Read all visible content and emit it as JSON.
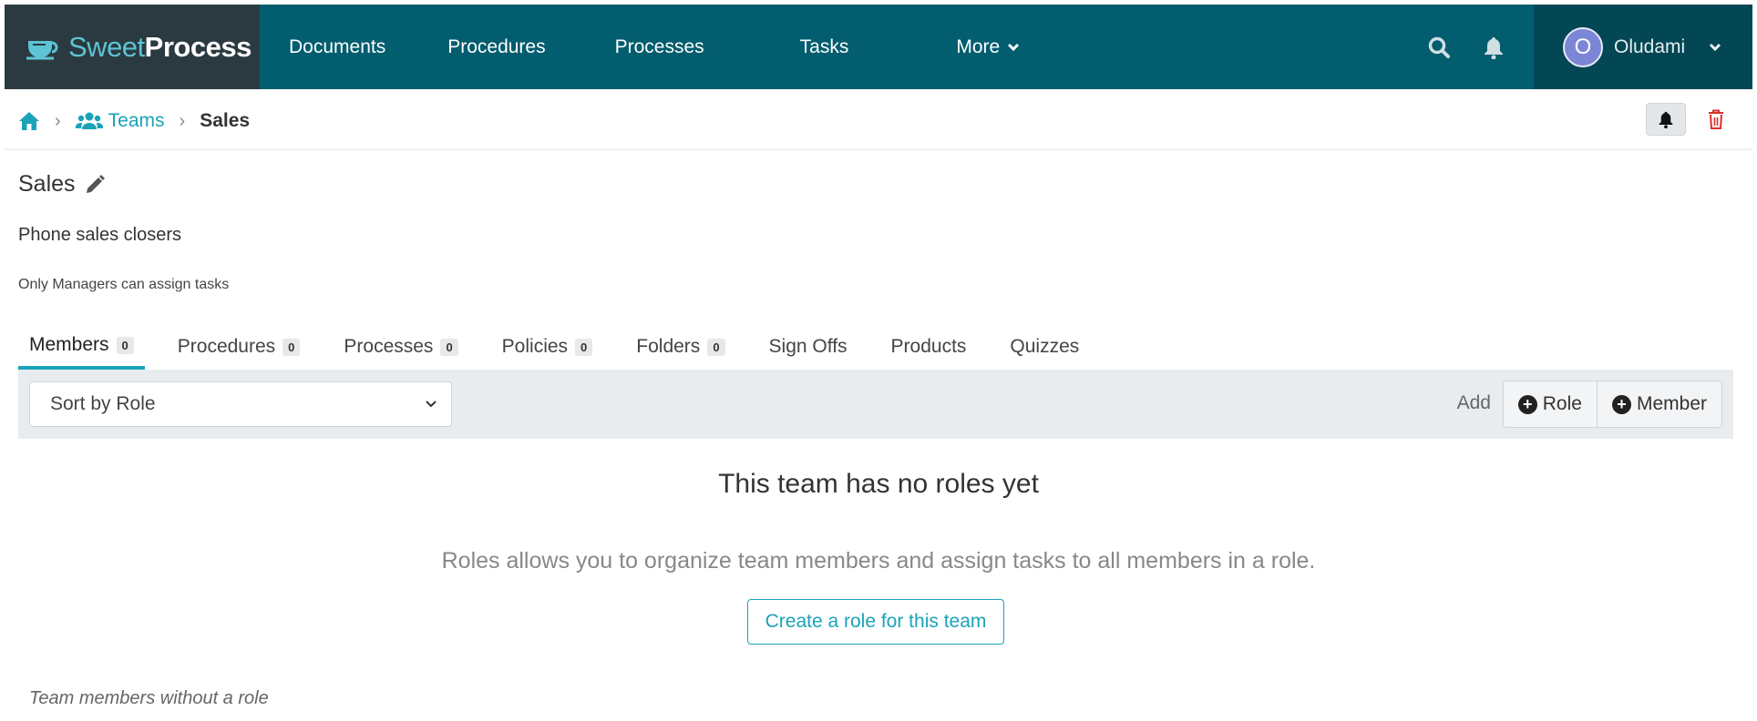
{
  "brand": {
    "name_light": "Sweet",
    "name_bold": "Process"
  },
  "nav": {
    "items": [
      {
        "label": "Documents"
      },
      {
        "label": "Procedures"
      },
      {
        "label": "Processes"
      },
      {
        "label": "Tasks"
      },
      {
        "label": "More"
      }
    ],
    "user": {
      "initial": "O",
      "name": "Oludami"
    }
  },
  "breadcrumb": {
    "teams": "Teams",
    "current": "Sales"
  },
  "team": {
    "title": "Sales",
    "description": "Phone sales closers",
    "note": "Only Managers can assign tasks"
  },
  "tabs": [
    {
      "label": "Members",
      "count": "0"
    },
    {
      "label": "Procedures",
      "count": "0"
    },
    {
      "label": "Processes",
      "count": "0"
    },
    {
      "label": "Policies",
      "count": "0"
    },
    {
      "label": "Folders",
      "count": "0"
    },
    {
      "label": "Sign Offs"
    },
    {
      "label": "Products"
    },
    {
      "label": "Quizzes"
    }
  ],
  "toolbar": {
    "sort_value": "Sort by Role",
    "add_label": "Add",
    "role_button": "Role",
    "member_button": "Member"
  },
  "empty_state": {
    "title": "This team has no roles yet",
    "text": "Roles allows you to organize team members and assign tasks to all members in a role.",
    "button": "Create a role for this team"
  },
  "members_without_role_label": "Team members without a role",
  "colors": {
    "nav_bg": "#025d6e",
    "brand_bg": "#2b3a40",
    "accent": "#1aa3b8",
    "delete": "#d9302c"
  }
}
